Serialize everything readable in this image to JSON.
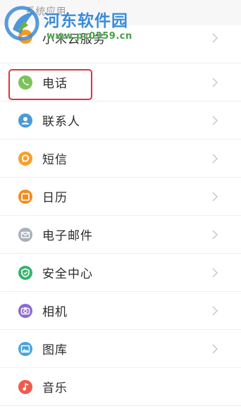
{
  "section": {
    "title": "系统应用"
  },
  "watermark": {
    "name": "河东软件园",
    "url": "www.pc0359.cn"
  },
  "rows": [
    {
      "label": "小米云服务",
      "icon": "cloud-icon",
      "color": "#f59a23"
    },
    {
      "label": "电话",
      "icon": "phone-icon",
      "color": "#7cc35b"
    },
    {
      "label": "联系人",
      "icon": "contacts-icon",
      "color": "#4a9ad6"
    },
    {
      "label": "短信",
      "icon": "message-icon",
      "color": "#f4a12b"
    },
    {
      "label": "日历",
      "icon": "calendar-icon",
      "color": "#f28c1f"
    },
    {
      "label": "电子邮件",
      "icon": "email-icon",
      "color": "#a9b0ba"
    },
    {
      "label": "安全中心",
      "icon": "security-shield-icon",
      "color": "#37b36b"
    },
    {
      "label": "相机",
      "icon": "camera-icon",
      "color": "#8a6ccf"
    },
    {
      "label": "图库",
      "icon": "gallery-icon",
      "color": "#4ba3db"
    },
    {
      "label": "音乐",
      "icon": "music-icon",
      "color": "#ef5b4c"
    }
  ],
  "highlighted_row": "电话",
  "highlight_color": "#d9363e"
}
